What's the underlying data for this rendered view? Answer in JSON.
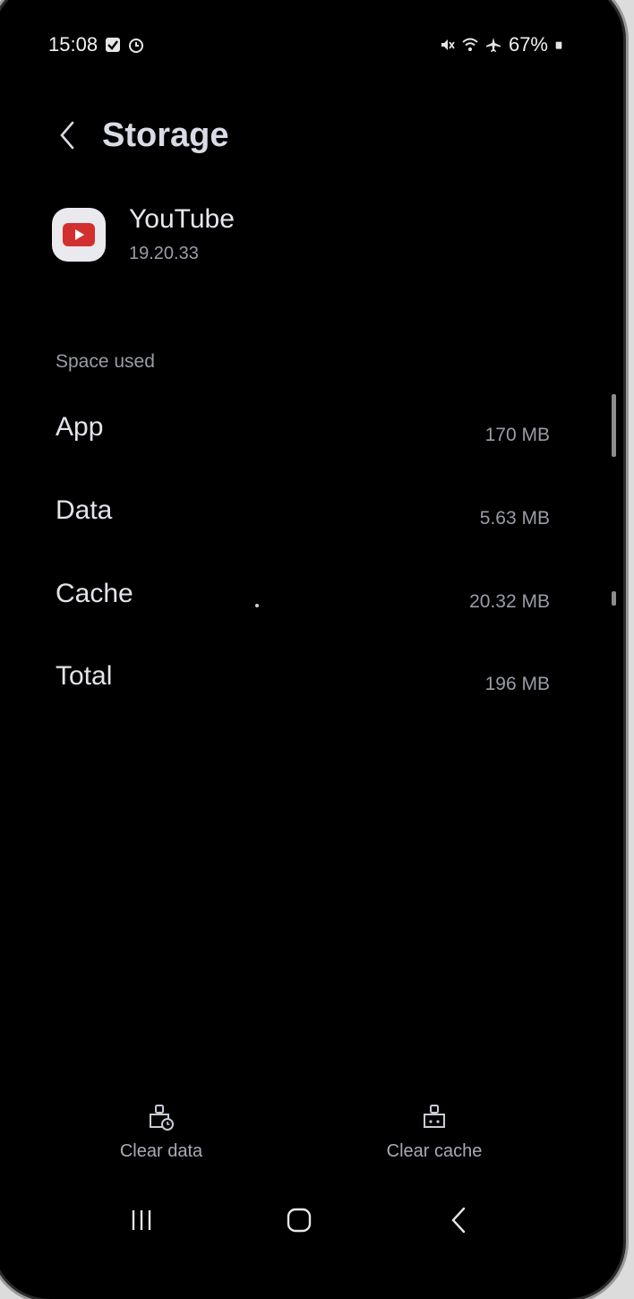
{
  "status_bar": {
    "time": "15:08",
    "battery": "67%"
  },
  "header": {
    "title": "Storage"
  },
  "app": {
    "name": "YouTube",
    "version": "19.20.33"
  },
  "section_label": "Space used",
  "rows": [
    {
      "label": "App",
      "value": "170 MB"
    },
    {
      "label": "Data",
      "value": "5.63 MB"
    },
    {
      "label": "Cache",
      "value": "20.32 MB"
    },
    {
      "label": "Total",
      "value": "196 MB"
    }
  ],
  "actions": {
    "clear_data": "Clear data",
    "clear_cache": "Clear cache"
  },
  "icons": {
    "status_left": [
      "check-box-icon",
      "alarm-icon"
    ],
    "status_right": [
      "mute-icon",
      "wifi-icon",
      "airplane-icon",
      "battery-icon"
    ],
    "nav": [
      "recents-icon",
      "home-icon",
      "back-icon"
    ]
  },
  "colors": {
    "background": "#000000",
    "accent_red": "#d32f2f"
  }
}
